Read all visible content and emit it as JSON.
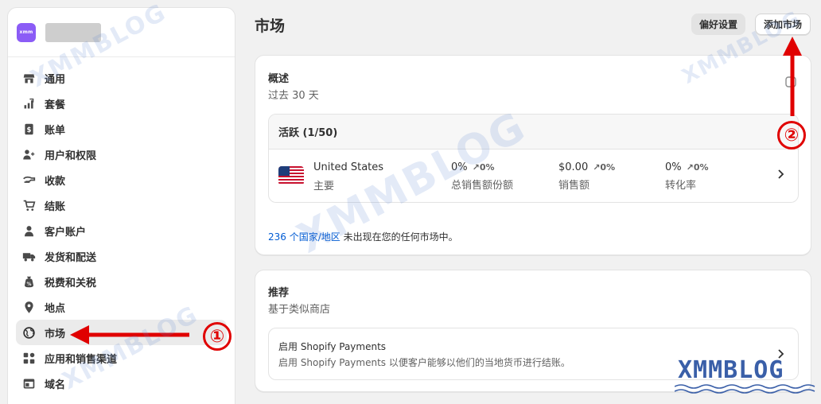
{
  "store": {
    "logo_text": "xmm"
  },
  "sidebar": {
    "items": [
      {
        "label": "通用",
        "icon": "store-icon"
      },
      {
        "label": "套餐",
        "icon": "plan-chart-icon"
      },
      {
        "label": "账单",
        "icon": "billing-icon"
      },
      {
        "label": "用户和权限",
        "icon": "users-icon"
      },
      {
        "label": "收款",
        "icon": "payments-icon"
      },
      {
        "label": "结账",
        "icon": "cart-icon"
      },
      {
        "label": "客户账户",
        "icon": "person-icon"
      },
      {
        "label": "发货和配送",
        "icon": "truck-icon"
      },
      {
        "label": "税费和关税",
        "icon": "tax-bag-icon"
      },
      {
        "label": "地点",
        "icon": "location-pin-icon"
      },
      {
        "label": "市场",
        "icon": "globe-icon",
        "active": true
      },
      {
        "label": "应用和销售渠道",
        "icon": "apps-icon"
      },
      {
        "label": "域名",
        "icon": "domain-icon"
      }
    ]
  },
  "header": {
    "title": "市场",
    "preferences_label": "偏好设置",
    "add_market_label": "添加市场"
  },
  "overview": {
    "title": "概述",
    "period": "过去 30 天",
    "active_header": "活跃 (1/50)",
    "market": {
      "name": "United States",
      "tag": "主要",
      "metrics": [
        {
          "value": "0%",
          "change": "↗0%",
          "label": "总销售额份额"
        },
        {
          "value": "$0.00",
          "change": "↗0%",
          "label": "销售额"
        },
        {
          "value": "0%",
          "change": "↗0%",
          "label": "转化率"
        }
      ]
    },
    "note_link": "236 个国家/地区",
    "note_text": " 未出现在您的任何市场中。"
  },
  "recommendations": {
    "title": "推荐",
    "subtitle": "基于类似商店",
    "item_title": "启用 Shopify Payments",
    "item_desc": "启用 Shopify Payments 以便客户能够以他们的当地货币进行结账。"
  },
  "annotations": {
    "one": "①",
    "two": "②"
  },
  "watermark": {
    "text": "XMMBLOG"
  },
  "colors": {
    "accent_red": "#e00000",
    "link_blue": "#005bd3",
    "logo_purple": "#8b5cf6"
  }
}
